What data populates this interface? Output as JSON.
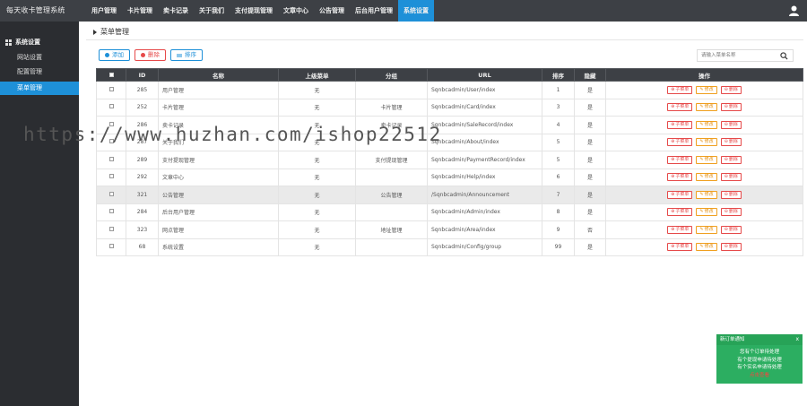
{
  "app": {
    "title": "每天收卡管理系统"
  },
  "topnav": [
    {
      "label": "用户管理",
      "active": false
    },
    {
      "label": "卡片管理",
      "active": false
    },
    {
      "label": "卖卡记录",
      "active": false
    },
    {
      "label": "关于我们",
      "active": false
    },
    {
      "label": "支付提现管理",
      "active": false
    },
    {
      "label": "文章中心",
      "active": false
    },
    {
      "label": "公告管理",
      "active": false
    },
    {
      "label": "后台用户管理",
      "active": false
    },
    {
      "label": "系统设置",
      "active": true
    }
  ],
  "sidebar": {
    "section": "系统设置",
    "items": [
      {
        "label": "网站设置",
        "active": false
      },
      {
        "label": "配置管理",
        "active": false
      },
      {
        "label": "菜单管理",
        "active": true
      }
    ]
  },
  "breadcrumb": "菜单管理",
  "toolbar": {
    "add": "添加",
    "delete": "删除",
    "sort": "排序"
  },
  "search": {
    "placeholder": "请输入菜单名称"
  },
  "table": {
    "headers": [
      "",
      "ID",
      "名称",
      "上级菜单",
      "分组",
      "URL",
      "排序",
      "隐藏",
      "操作"
    ],
    "rows": [
      {
        "id": "285",
        "name": "用户管理",
        "parent": "无",
        "group": "",
        "url": "Sqnbcadmin/User/index",
        "sort": "1",
        "hidden": "是",
        "hl": false
      },
      {
        "id": "252",
        "name": "卡片管理",
        "parent": "无",
        "group": "卡片管理",
        "url": "Sqnbcadmin/Card/index",
        "sort": "3",
        "hidden": "是",
        "hl": false
      },
      {
        "id": "286",
        "name": "卖卡记录",
        "parent": "无",
        "group": "卖卡记录",
        "url": "Sqnbcadmin/SaleRecord/index",
        "sort": "4",
        "hidden": "是",
        "hl": false
      },
      {
        "id": "287",
        "name": "关于我们",
        "parent": "无",
        "group": "",
        "url": "Sqnbcadmin/About/index",
        "sort": "5",
        "hidden": "是",
        "hl": false
      },
      {
        "id": "289",
        "name": "支付提现管理",
        "parent": "无",
        "group": "支付提现管理",
        "url": "Sqnbcadmin/PaymentRecord/index",
        "sort": "5",
        "hidden": "是",
        "hl": false
      },
      {
        "id": "292",
        "name": "文章中心",
        "parent": "无",
        "group": "",
        "url": "Sqnbcadmin/Help/index",
        "sort": "6",
        "hidden": "是",
        "hl": false
      },
      {
        "id": "321",
        "name": "公告管理",
        "parent": "无",
        "group": "公告管理",
        "url": "/Sqnbcadmin/Announcement",
        "sort": "7",
        "hidden": "是",
        "hl": true
      },
      {
        "id": "284",
        "name": "后台用户管理",
        "parent": "无",
        "group": "",
        "url": "Sqnbcadmin/Admin/index",
        "sort": "8",
        "hidden": "是",
        "hl": false
      },
      {
        "id": "323",
        "name": "网点管理",
        "parent": "无",
        "group": "地址管理",
        "url": "Sqnbcadmin/Area/index",
        "sort": "9",
        "hidden": "否",
        "hl": false
      },
      {
        "id": "68",
        "name": "系统设置",
        "parent": "无",
        "group": "",
        "url": "Sqnbcadmin/Config/group",
        "sort": "99",
        "hidden": "是",
        "hl": false
      }
    ],
    "actions": {
      "submenu": "子菜单",
      "edit": "修改",
      "delete": "删除"
    }
  },
  "toast": {
    "title": "新订单通知",
    "close": "x",
    "lines": [
      {
        "prefix": "您有",
        "count": "",
        "suffix": "个订单待处理"
      },
      {
        "prefix": "有",
        "count": "",
        "suffix": "个提现申请待处理"
      },
      {
        "prefix": "有",
        "count": "",
        "suffix": "个实名申请待处理"
      }
    ],
    "link": "点击查看"
  },
  "watermark": "https://www.huzhan.com/ishop22512",
  "colors": {
    "topbar": "#3d4045",
    "sidebar": "#2b2d31",
    "accent": "#1e90d8",
    "danger": "#e64a4a",
    "toast": "#2cae61"
  }
}
